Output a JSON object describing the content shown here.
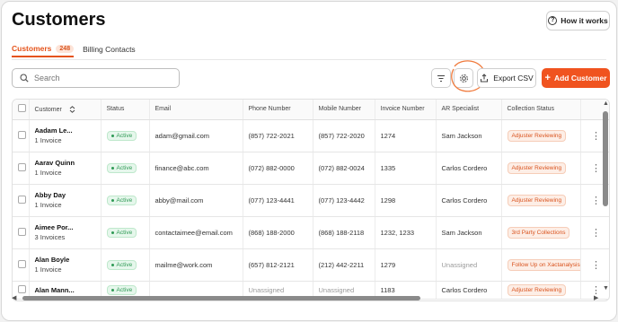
{
  "page": {
    "title": "Customers",
    "how_it_works": "How it works"
  },
  "tabs": [
    {
      "label": "Customers",
      "count": "248"
    },
    {
      "label": "Billing Contacts"
    }
  ],
  "toolbar": {
    "search_placeholder": "Search",
    "export_label": "Export CSV",
    "add_label": "Add Customer"
  },
  "table": {
    "columns": [
      "Customer",
      "Status",
      "Email",
      "Phone Number",
      "Mobile Number",
      "Invoice Number",
      "AR Specialist",
      "Collection Status"
    ],
    "rows": [
      {
        "name": "Aadam Le...",
        "invoices": "1 Invoice",
        "status": "Active",
        "email": "adam@gmail.com",
        "phone": "(857) 722-2021",
        "mobile": "(857) 722-2020",
        "invoice_number": "1274",
        "specialist": "Sam Jackson",
        "collection": "Adjuster Reviewing"
      },
      {
        "name": "Aarav Quinn",
        "invoices": "1 Invoice",
        "status": "Active",
        "email": "finance@abc.com",
        "phone": "(072) 882-0000",
        "mobile": "(072) 882-0024",
        "invoice_number": "1335",
        "specialist": "Carlos Cordero",
        "collection": "Adjuster Reviewing"
      },
      {
        "name": "Abby Day",
        "invoices": "1 Invoice",
        "status": "Active",
        "email": "abby@mail.com",
        "phone": "(077) 123-4441",
        "mobile": "(077) 123-4442",
        "invoice_number": "1298",
        "specialist": "Carlos Cordero",
        "collection": "Adjuster Reviewing"
      },
      {
        "name": "Aimee Por...",
        "invoices": "3 Invoices",
        "status": "Active",
        "email": "contactaimee@email.com",
        "phone": "(868) 188-2000",
        "mobile": "(868) 188-2118",
        "invoice_number": "1232, 1233",
        "specialist": "Sam Jackson",
        "collection": "3rd Party Collections"
      },
      {
        "name": "Alan Boyle",
        "invoices": "1 Invoice",
        "status": "Active",
        "email": "mailme@work.com",
        "phone": "(657) 812-2121",
        "mobile": "(212) 442-2211",
        "invoice_number": "1279",
        "specialist": "Unassigned",
        "collection": "Follow Up on Xactanalysis"
      },
      {
        "name": "Alan Mann...",
        "invoices": "",
        "status": "Active",
        "email": "",
        "phone": "Unassigned",
        "mobile": "Unassigned",
        "invoice_number": "1183",
        "specialist": "Carlos Cordero",
        "collection": "Adjuster Reviewing"
      }
    ]
  },
  "colors": {
    "accent": "#f0531f",
    "status_green": "#2f9a55",
    "annotation": "#f07a3c"
  },
  "icons": [
    "help-icon",
    "search-icon",
    "sort-icon",
    "filter-lines-icon",
    "gear-icon",
    "export-icon",
    "plus-icon",
    "more-vertical-icon"
  ]
}
